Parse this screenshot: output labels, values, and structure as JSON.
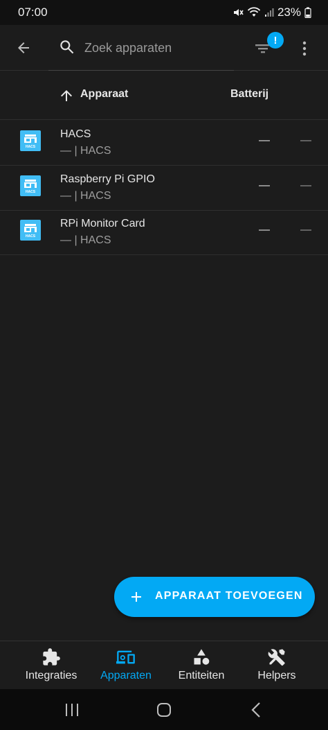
{
  "status_bar": {
    "time": "07:00",
    "battery": "23%",
    "icons": [
      "mute-icon",
      "wifi-icon",
      "signal-icon",
      "battery-icon"
    ]
  },
  "toolbar": {
    "search_placeholder": "Zoek apparaten",
    "filter_badge": "!"
  },
  "table": {
    "columns": {
      "name": "Apparaat",
      "battery": "Batterij"
    },
    "rows": [
      {
        "name": "HACS",
        "subtitle": "— | HACS",
        "battery": "—",
        "extra": "—"
      },
      {
        "name": "Raspberry Pi GPIO",
        "subtitle": "— | HACS",
        "battery": "—",
        "extra": "—"
      },
      {
        "name": "RPi Monitor Card",
        "subtitle": "— | HACS",
        "battery": "—",
        "extra": "—"
      }
    ]
  },
  "fab": {
    "label": "APPARAAT TOEVOEGEN"
  },
  "bottom_nav": [
    {
      "label": "Integraties",
      "icon": "puzzle-icon",
      "active": false
    },
    {
      "label": "Apparaten",
      "icon": "devices-icon",
      "active": true
    },
    {
      "label": "Entiteiten",
      "icon": "shapes-icon",
      "active": false
    },
    {
      "label": "Helpers",
      "icon": "tools-icon",
      "active": false
    }
  ],
  "colors": {
    "accent": "#03a9f4",
    "hacs_logo": "#41bdf5",
    "background": "#1c1c1c"
  }
}
